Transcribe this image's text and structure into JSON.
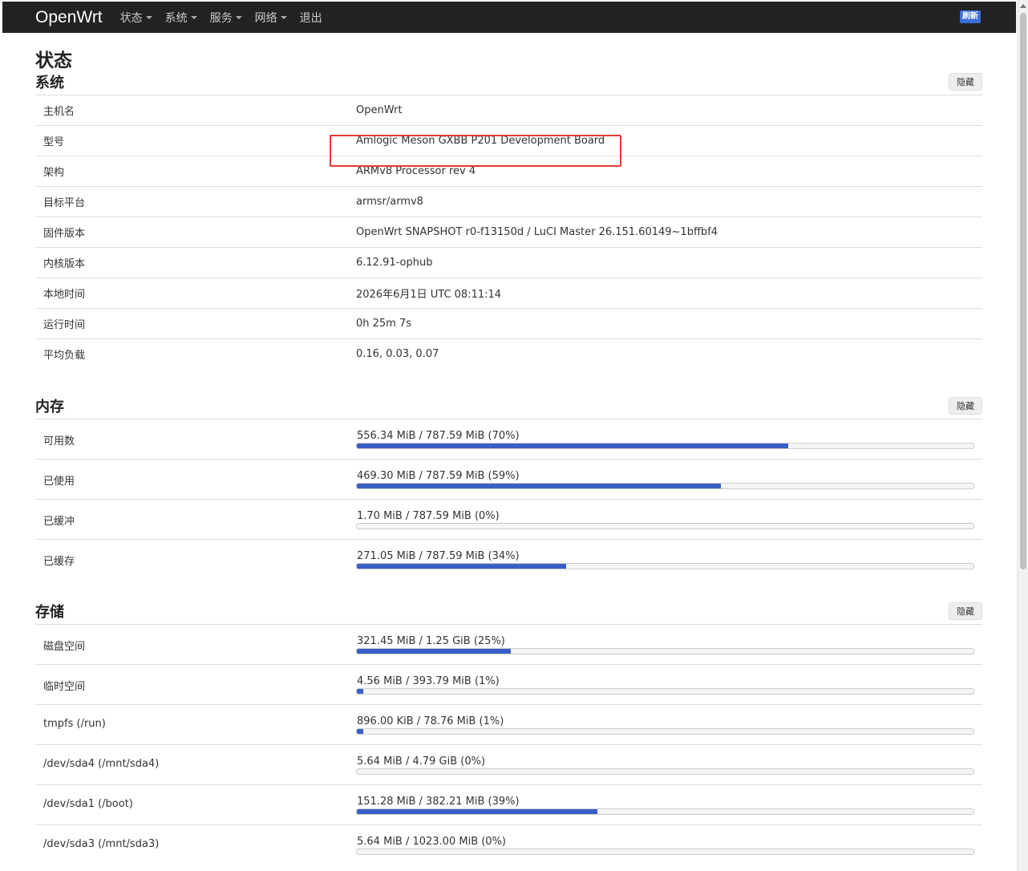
{
  "navbar": {
    "brand": "OpenWrt",
    "menu": [
      {
        "label": "状态",
        "dropdown": true
      },
      {
        "label": "系统",
        "dropdown": true
      },
      {
        "label": "服务",
        "dropdown": true
      },
      {
        "label": "网络",
        "dropdown": true
      },
      {
        "label": "退出",
        "dropdown": false
      }
    ],
    "refresh_label": "刷新"
  },
  "page": {
    "title": "状态"
  },
  "system": {
    "title": "系统",
    "hide_label": "隐藏",
    "rows": [
      {
        "label": "主机名",
        "value": "OpenWrt"
      },
      {
        "label": "型号",
        "value": "Amlogic Meson GXBB P201 Development Board"
      },
      {
        "label": "架构",
        "value": "ARMv8 Processor rev 4"
      },
      {
        "label": "目标平台",
        "value": "armsr/armv8"
      },
      {
        "label": "固件版本",
        "value": "OpenWrt SNAPSHOT r0-f13150d / LuCI Master 26.151.60149~1bffbf4"
      },
      {
        "label": "内核版本",
        "value": "6.12.91-ophub"
      },
      {
        "label": "本地时间",
        "value": "2026年6月1日 UTC 08:11:14"
      },
      {
        "label": "运行时间",
        "value": "0h 25m 7s"
      },
      {
        "label": "平均负载",
        "value": "0.16, 0.03, 0.07"
      }
    ]
  },
  "memory": {
    "title": "内存",
    "hide_label": "隐藏",
    "rows": [
      {
        "label": "可用数",
        "text": "556.34 MiB / 787.59 MiB (70%)",
        "percent": 70
      },
      {
        "label": "已使用",
        "text": "469.30 MiB / 787.59 MiB (59%)",
        "percent": 59
      },
      {
        "label": "已缓冲",
        "text": "1.70 MiB / 787.59 MiB (0%)",
        "percent": 0
      },
      {
        "label": "已缓存",
        "text": "271.05 MiB / 787.59 MiB (34%)",
        "percent": 34
      }
    ]
  },
  "storage": {
    "title": "存储",
    "hide_label": "隐藏",
    "rows": [
      {
        "label": "磁盘空间",
        "text": "321.45 MiB / 1.25 GiB (25%)",
        "percent": 25
      },
      {
        "label": "临时空间",
        "text": "4.56 MiB / 393.79 MiB (1%)",
        "percent": 1
      },
      {
        "label": "tmpfs (/run)",
        "text": "896.00 KiB / 78.76 MiB (1%)",
        "percent": 1
      },
      {
        "label": "/dev/sda4 (/mnt/sda4)",
        "text": "5.64 MiB / 4.79 GiB (0%)",
        "percent": 0
      },
      {
        "label": "/dev/sda1 (/boot)",
        "text": "151.28 MiB / 382.21 MiB (39%)",
        "percent": 39
      },
      {
        "label": "/dev/sda3 (/mnt/sda3)",
        "text": "5.64 MiB / 1023.00 MiB (0%)",
        "percent": 0
      }
    ]
  },
  "colors": {
    "navbar_bg": "#222222",
    "bar_fill": "#3a5fc4",
    "highlight": "#e53935"
  }
}
